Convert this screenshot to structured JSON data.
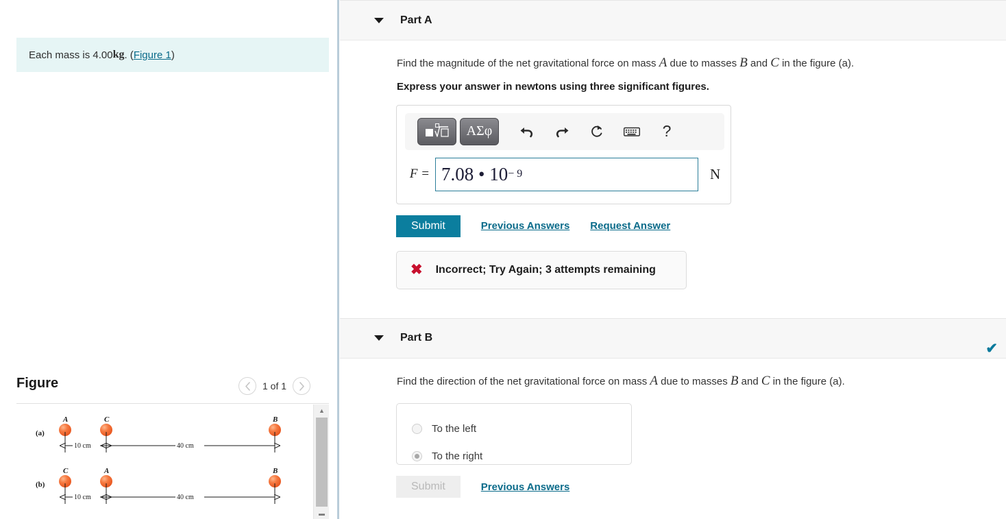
{
  "left": {
    "intro": {
      "prefix": "Each mass is 4.00 ",
      "unit": "kg",
      "mid": ". (",
      "link": "Figure 1",
      "suffix": ")"
    },
    "figure": {
      "title": "Figure",
      "counter": "1 of 1",
      "prev_icon": "chevron-left-icon",
      "next_icon": "chevron-right-icon",
      "rows": [
        {
          "tag": "(a)",
          "masses": [
            "A",
            "C",
            "B"
          ],
          "dim_left": "10 cm",
          "dim_right": "40 cm"
        },
        {
          "tag": "(b)",
          "masses": [
            "C",
            "A",
            "B"
          ],
          "dim_left": "10 cm",
          "dim_right": "40 cm"
        }
      ]
    }
  },
  "partA": {
    "label": "Part A",
    "caret_icon": "caret-down-icon",
    "question_pre": "Find the magnitude of the net gravitational force on mass ",
    "var1": "A",
    "question_mid1": " due to masses ",
    "var2": "B",
    "question_mid2": " and ",
    "var3": "C",
    "question_post": " in the figure (a).",
    "instruction": "Express your answer in newtons using three significant figures.",
    "toolbar": {
      "math_template_button": "math-template-icon",
      "greek_button": "ΑΣφ",
      "undo_icon": "undo-icon",
      "redo_icon": "redo-icon",
      "reset_icon": "reset-icon",
      "keyboard_icon": "keyboard-icon",
      "help_icon": "help-icon"
    },
    "answer": {
      "variable": "F =",
      "value_mantissa": "7.08 • 10",
      "value_exponent": "− 9",
      "unit": "N"
    },
    "submit_label": "Submit",
    "previous_answers_label": "Previous Answers",
    "request_answer_label": "Request Answer",
    "feedback": {
      "icon": "x-mark-icon",
      "text": "Incorrect; Try Again; 3 attempts remaining"
    }
  },
  "partB": {
    "label": "Part B",
    "caret_icon": "caret-down-icon",
    "status_icon": "check-mark-icon",
    "question_pre": "Find the direction of the net gravitational force on mass ",
    "var1": "A",
    "question_mid1": " due to masses ",
    "var2": "B",
    "question_mid2": " and ",
    "var3": "C",
    "question_post": " in the figure (a).",
    "options": [
      {
        "label": "To the left",
        "selected": false
      },
      {
        "label": "To the right",
        "selected": true
      }
    ],
    "submit_label": "Submit",
    "previous_answers_label": "Previous Answers"
  },
  "colors": {
    "accent_teal": "#0b7e9e",
    "link": "#0a6b8a",
    "error_red": "#c8102e",
    "banner_bg": "#e6f5f5",
    "mass_orange": "#f2703a"
  }
}
